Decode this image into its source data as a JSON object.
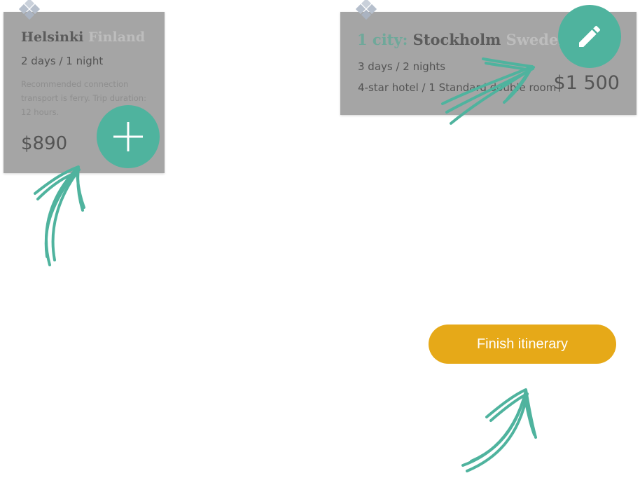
{
  "cards": [
    {
      "city": "Helsinki",
      "country": "Finland",
      "duration": "2 days / 1 night",
      "description": "Recommended connection transport is ferry. Trip duration: 12 hours.",
      "price": "$890",
      "action_icon": "plus-icon"
    },
    {
      "city_count": "1 city:",
      "city": "Stockholm",
      "country": "Sweden",
      "duration": "3 days / 2 nights",
      "hotel": "4-star hotel / 1 Standard double room",
      "price": "$1 500",
      "action_icon": "pencil-icon"
    }
  ],
  "finish_button": {
    "label": "Finish itinerary"
  },
  "colors": {
    "accent_teal": "#4fb39e",
    "finish_yellow": "#e6a918",
    "card_overlay": "#a5a5a5",
    "city_count_text": "#6fa89a"
  }
}
